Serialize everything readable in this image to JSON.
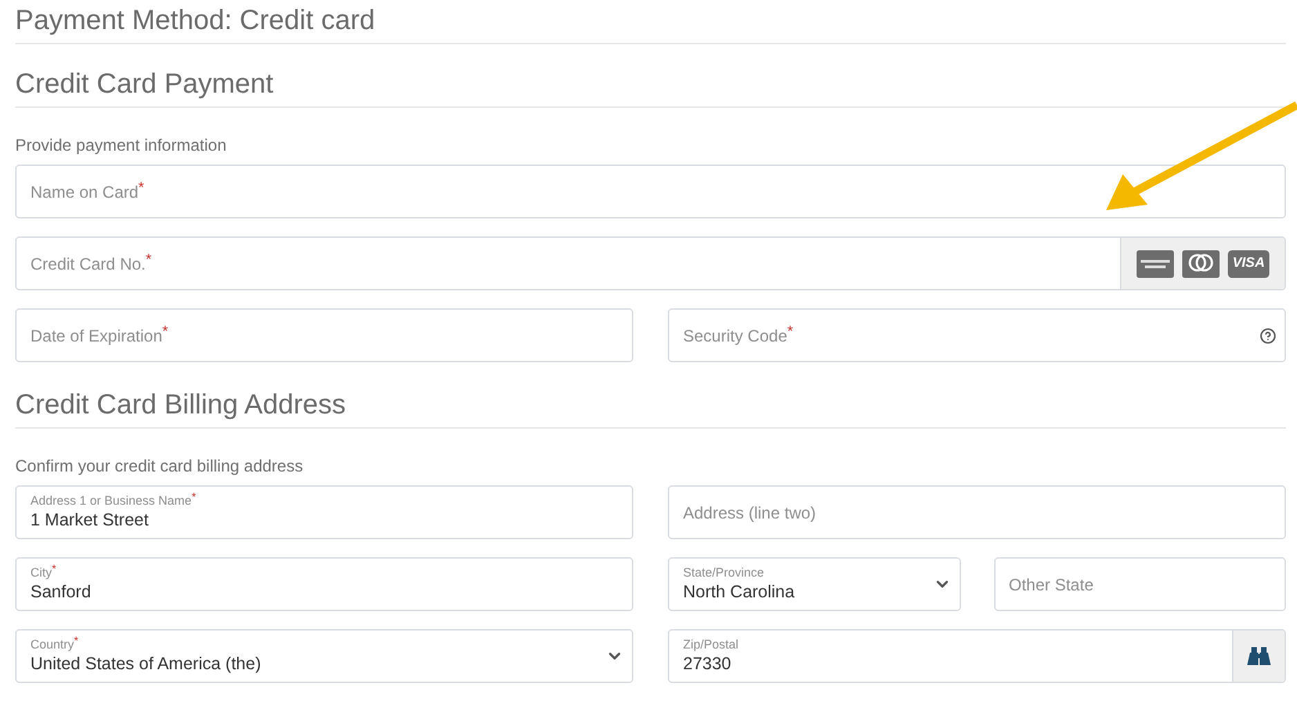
{
  "page_title": "Payment Method: Credit card",
  "sections": [
    {
      "title": "Credit Card Payment",
      "caption": "Provide payment information",
      "rows": [
        [
          [
            {
              "label": "Name on Card$^{*}$"
            }
          ]
        ],
        [
          [
            {
              "label": "Credit Card No.$^{*}$",
              "card_logos": true
            }
          ]
        ],
        [
          [
            {
              "label": "Date of Expiration$^{*}$"
            }
          ],
          [
            {
              "label": "Security Code$^{*}$",
              "help": true
            }
          ]
        ]
      ]
    },
    {
      "title": "Credit Card Billing Address",
      "caption": "Confirm your credit card billing address",
      "rows": [
        [
          [
            {
              "label": "Address 1 or Business Name$^{*}$",
              "value": "1 Market Street"
            }
          ],
          [
            {
              "label": "Address (line two)"
            }
          ]
        ],
        [
          [
            {
              "label": "City$^{*}$",
              "value": "Sanford"
            }
          ],
          [
            {
              "label": "State/Province",
              "value": "North Carolina",
              "dropdown": true
            },
            {
              "label": "Other State"
            }
          ]
        ],
        [
          [
            {
              "label": "Country$^{*}$",
              "value": "United States of America (the)",
              "dropdown": true
            }
          ],
          [
            {
              "label": "Zip/Postal",
              "value": "27330",
              "lookup_button": true
            }
          ]
        ]
      ]
    }
  ],
  "card_logos": [
    {
      "kind": "amex"
    },
    {
      "kind": "mastercard"
    },
    {
      "kind": "visa",
      "label": "VISA"
    }
  ],
  "annotations": [
    {
      "kind": "arrow"
    }
  ]
}
